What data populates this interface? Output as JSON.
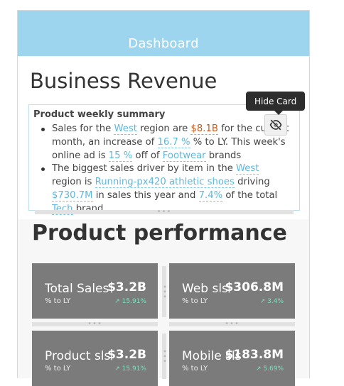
{
  "header": {
    "title": "Dashboard"
  },
  "revenue_card": {
    "title": "Business Revenue",
    "summary_title": "Product weekly summary",
    "bullet1": {
      "t1": "Sales for the ",
      "region": "West",
      "t2": " region are ",
      "amount": "$8.1B",
      "t3": " for the current month, an increase of ",
      "pct": "16.7 %",
      "t4": " % to LY. This week's online ad is ",
      "ad_pct": "15 %",
      "t5": " off of ",
      "category": "Footwear",
      "t6": " brands"
    },
    "bullet2": {
      "t1": "The biggest sales driver by item in the ",
      "region": "West",
      "t2": " region is ",
      "item": "Running-px420 athletic shoes",
      "t3": "  driving ",
      "amount": "$730.7M",
      "t4": " in sales this year and ",
      "pct": "7.4%",
      "t5": " of the total ",
      "category": "Tech",
      "t6": " brand"
    },
    "hide_button_tooltip": "Hide Card",
    "hide_icon": "eye-off-icon"
  },
  "performance": {
    "title": "Product performance",
    "kpis": [
      {
        "label": "Total Sales",
        "value": "$3.2B",
        "sub": "% to LY",
        "change": "15.91%"
      },
      {
        "label": "Web sls",
        "value": "$306.8M",
        "sub": "% to LY",
        "change": "3.4%"
      },
      {
        "label": "Product sls",
        "value": "$3.2B",
        "sub": "% to LY",
        "change": "15.91%"
      },
      {
        "label": "Mobile sls",
        "value": "$183.8M",
        "sub": "% to LY",
        "change": "5.69%"
      }
    ]
  },
  "colors": {
    "header_bg": "#9dd4ee",
    "highlight": "#5cb8e0",
    "highlight_money": "#d25a1a",
    "kpi_bg": "#7b7b7b",
    "kpi_change": "#7fe3c0"
  }
}
